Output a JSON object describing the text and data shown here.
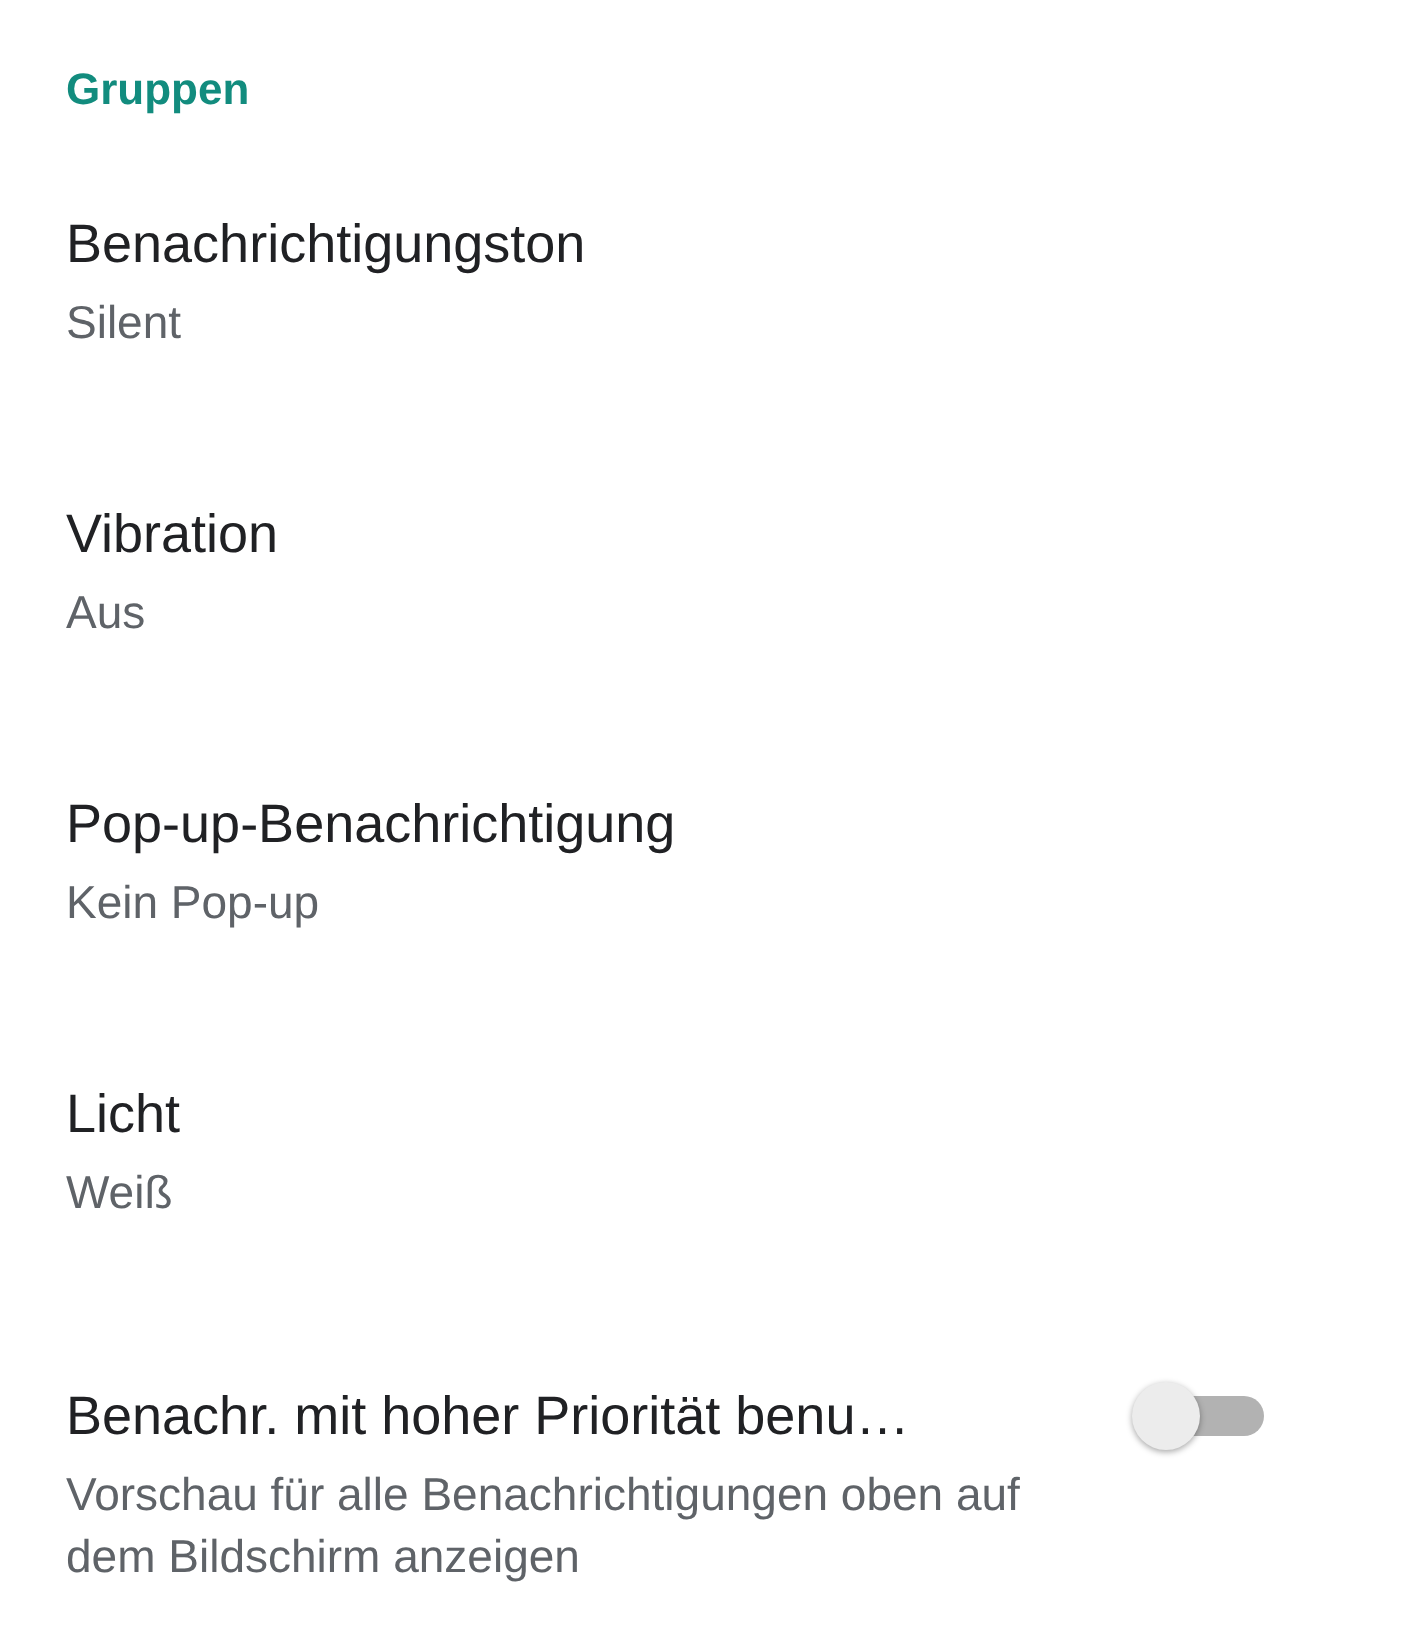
{
  "section_header": "Gruppen",
  "settings": [
    {
      "kind": "option",
      "title": "Benachrichtigungston",
      "subtitle": "Silent"
    },
    {
      "kind": "option",
      "title": "Vibration",
      "subtitle": "Aus"
    },
    {
      "kind": "option",
      "title": "Pop-up-Benachrichtigung",
      "subtitle": "Kein Pop-up"
    },
    {
      "kind": "option",
      "title": "Licht",
      "subtitle": "Weiß"
    },
    {
      "kind": "toggle",
      "title": "Benachr. mit hoher Priorität benu…",
      "subtitle": "Vorschau für alle Benachrichtigungen oben auf dem Bildschirm anzeigen",
      "on": false
    }
  ]
}
